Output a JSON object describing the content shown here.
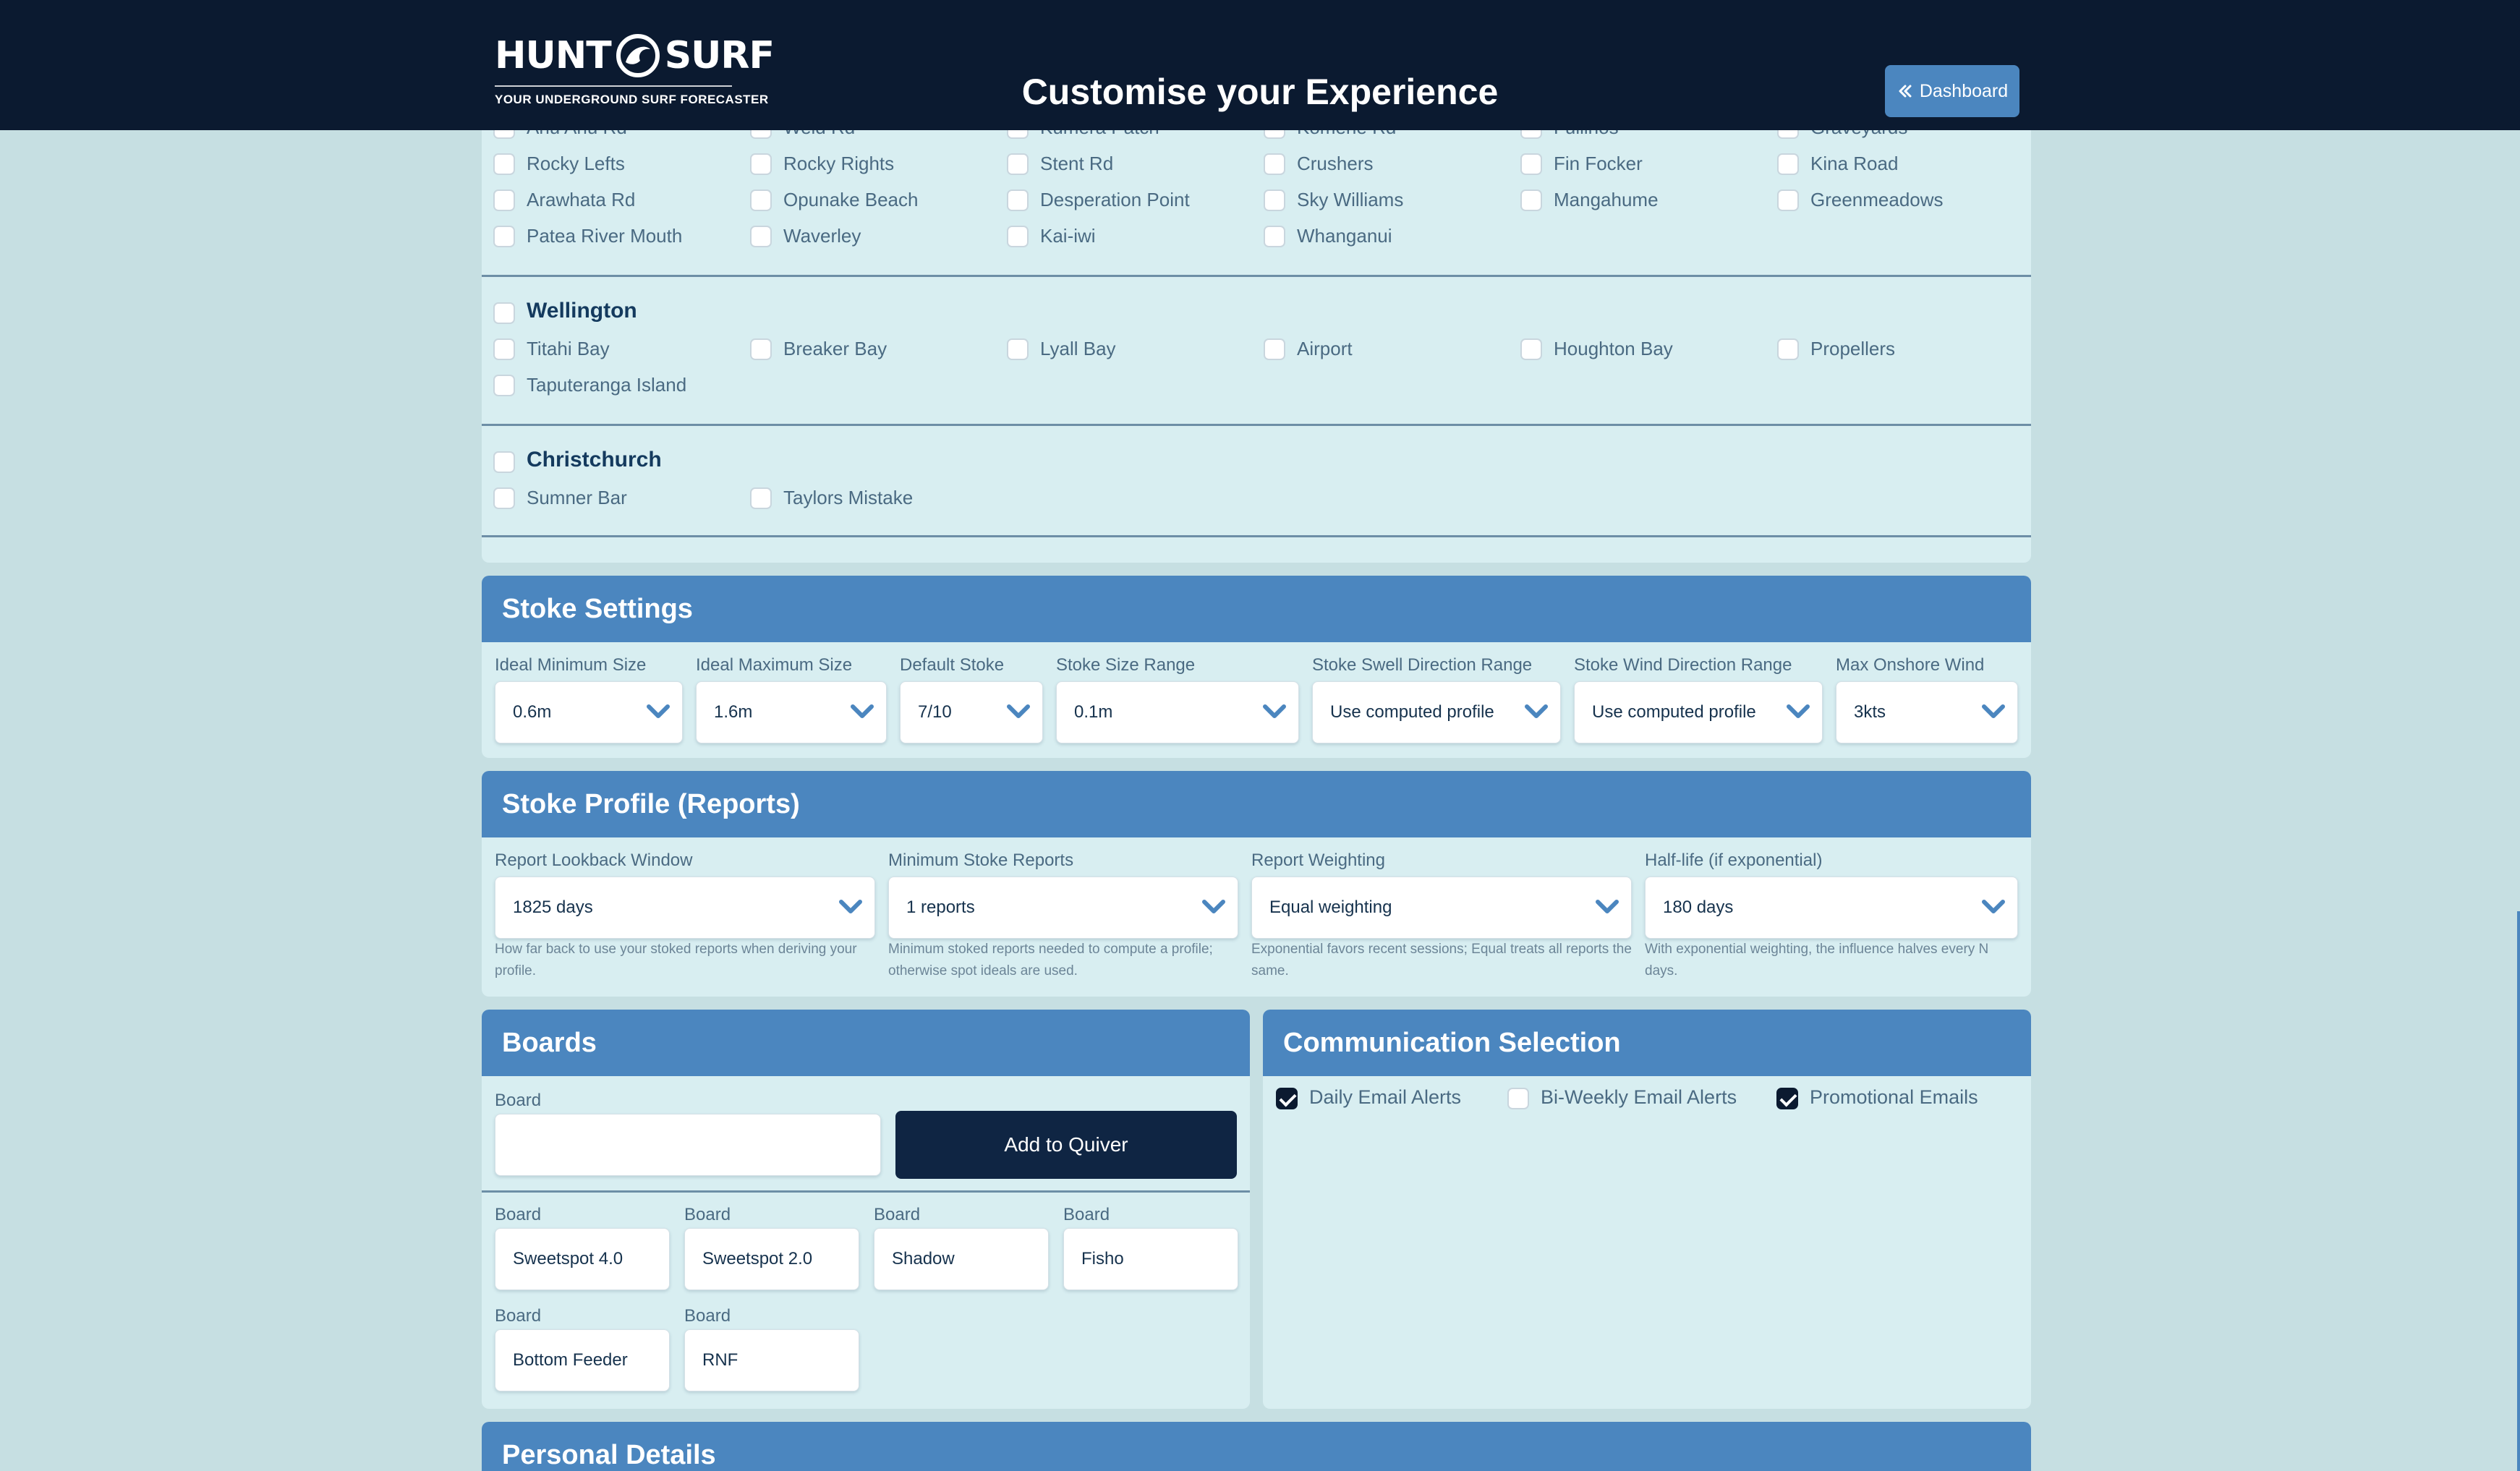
{
  "header": {
    "logo_word_left": "HUNT",
    "logo_word_right": "SURF",
    "logo_tagline": "YOUR UNDERGROUND SURF FORECASTER",
    "title": "Customise your Experience",
    "dashboard_button": "Dashboard"
  },
  "spots": {
    "taranaki_partial_row": [
      "Ahu Ahu Rd",
      "Weld Rd",
      "Kumera Patch",
      "Komene Rd",
      "Fullinos",
      "Graveyards"
    ],
    "taranaki_rows": [
      [
        "Rocky Lefts",
        "Rocky Rights",
        "Stent Rd",
        "Crushers",
        "Fin Focker",
        "Kina Road"
      ],
      [
        "Arawhata Rd",
        "Opunake Beach",
        "Desperation Point",
        "Sky Williams",
        "Mangahume",
        "Greenmeadows"
      ],
      [
        "Patea River Mouth",
        "Waverley",
        "Kai-iwi",
        "Whanganui"
      ]
    ],
    "wellington": {
      "name": "Wellington",
      "spots": [
        "Titahi Bay",
        "Breaker Bay",
        "Lyall Bay",
        "Airport",
        "Houghton Bay",
        "Propellers",
        "Taputeranga Island"
      ]
    },
    "christchurch": {
      "name": "Christchurch",
      "spots": [
        "Sumner Bar",
        "Taylors Mistake"
      ]
    }
  },
  "stoke_settings": {
    "title": "Stoke Settings",
    "fields": [
      {
        "label": "Ideal Minimum Size",
        "value": "0.6m"
      },
      {
        "label": "Ideal Maximum Size",
        "value": "1.6m"
      },
      {
        "label": "Default Stoke",
        "value": "7/10"
      },
      {
        "label": "Stoke Size Range",
        "value": "0.1m"
      },
      {
        "label": "Stoke Swell Direction Range",
        "value": "Use computed profile"
      },
      {
        "label": "Stoke Wind Direction Range",
        "value": "Use computed profile"
      },
      {
        "label": "Max Onshore Wind",
        "value": "3kts"
      }
    ]
  },
  "stoke_profile": {
    "title": "Stoke Profile (Reports)",
    "fields": [
      {
        "label": "Report Lookback Window",
        "value": "1825 days",
        "help": "How far back to use your stoked reports when deriving your profile."
      },
      {
        "label": "Minimum Stoke Reports",
        "value": "1 reports",
        "help": "Minimum stoked reports needed to compute a profile; otherwise spot ideals are used."
      },
      {
        "label": "Report Weighting",
        "value": "Equal weighting",
        "help": "Exponential favors recent sessions; Equal treats all reports the same."
      },
      {
        "label": "Half-life (if exponential)",
        "value": "180 days",
        "help": "With exponential weighting, the influence halves every N days."
      }
    ]
  },
  "boards": {
    "title": "Boards",
    "new_board_label": "Board",
    "new_board_value": "",
    "add_button": "Add to Quiver",
    "items": [
      {
        "label": "Board",
        "value": "Sweetspot 4.0"
      },
      {
        "label": "Board",
        "value": "Sweetspot 2.0"
      },
      {
        "label": "Board",
        "value": "Shadow"
      },
      {
        "label": "Board",
        "value": "Fisho"
      },
      {
        "label": "Board",
        "value": "Bottom Feeder"
      },
      {
        "label": "Board",
        "value": "RNF"
      }
    ]
  },
  "communication": {
    "title": "Communication Selection",
    "options": [
      {
        "label": "Daily Email Alerts",
        "checked": true
      },
      {
        "label": "Bi-Weekly Email Alerts",
        "checked": false
      },
      {
        "label": "Promotional Emails",
        "checked": true
      }
    ]
  },
  "personal": {
    "title": "Personal Details"
  },
  "colors": {
    "background": "#c6dfe2",
    "header": "#0b1a30",
    "accent": "#4b86bf",
    "panel": "#d8eef1"
  }
}
